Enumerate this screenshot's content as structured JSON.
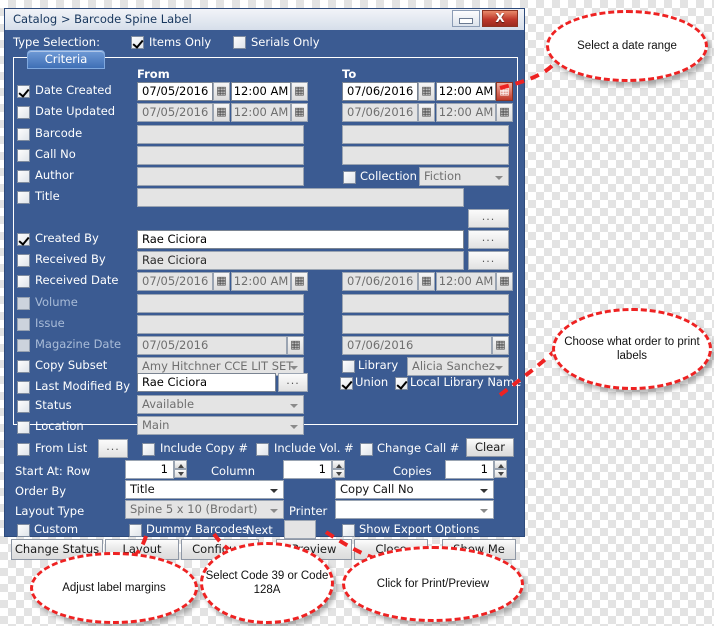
{
  "window": {
    "title": "Catalog > Barcode Spine Label",
    "minimize_label": "minimize",
    "close_label": "X"
  },
  "type_selection": {
    "label": "Type Selection:",
    "items_only": {
      "label": "Items Only",
      "checked": true
    },
    "serials_only": {
      "label": "Serials Only",
      "checked": false
    }
  },
  "criteria": {
    "tab_label": "Criteria",
    "from_header": "From",
    "to_header": "To",
    "rows": [
      {
        "label": "Date Created",
        "checked": true,
        "from_date": "07/05/2016",
        "from_time": "12:00 AM",
        "to_date": "07/06/2016",
        "to_time": "12:00 AM"
      },
      {
        "label": "Date Updated",
        "checked": false,
        "from_date": "07/05/2016",
        "from_time": "12:00 AM",
        "to_date": "07/06/2016",
        "to_time": "12:00 AM"
      },
      {
        "label": "Barcode",
        "checked": false,
        "from_value": "",
        "to_value": ""
      },
      {
        "label": "Call No",
        "checked": false,
        "from_value": "",
        "to_value": ""
      },
      {
        "label": "Author",
        "checked": false,
        "from_value": ""
      },
      {
        "label": "Title",
        "checked": false,
        "value": ""
      },
      {
        "label": "Created By",
        "checked": true,
        "value": "Rae Ciciora"
      },
      {
        "label": "Received By",
        "checked": false,
        "value": "Rae Ciciora"
      },
      {
        "label": "Received Date",
        "checked": false,
        "from_date": "07/05/2016",
        "from_time": "12:00 AM",
        "to_date": "07/06/2016",
        "to_time": "12:00 AM"
      },
      {
        "label": "Volume",
        "checked": false,
        "dim": true,
        "from_value": "",
        "to_value": ""
      },
      {
        "label": "Issue",
        "checked": false,
        "dim": true,
        "from_value": "",
        "to_value": ""
      },
      {
        "label": "Magazine Date",
        "checked": false,
        "dim": true,
        "from_date": "07/05/2016",
        "to_date": "07/06/2016"
      },
      {
        "label": "Copy Subset",
        "checked": false,
        "value": "Amy Hitchner CCE LIT SET"
      },
      {
        "label": "Last Modified By",
        "checked": false,
        "value": "Rae Ciciora"
      },
      {
        "label": "Status",
        "checked": false,
        "value": "Available"
      },
      {
        "label": "Location",
        "checked": false,
        "value": "Main"
      }
    ],
    "collection": {
      "label": "Collection",
      "checked": false,
      "value": "Fiction"
    },
    "library": {
      "label": "Library",
      "checked": false,
      "value": "Alicia Sanchez"
    },
    "union": {
      "label": "Union",
      "checked": true
    },
    "local_library_name": {
      "label": "Local Library Name",
      "checked": true
    },
    "from_list": {
      "label": "From List",
      "checked": false
    },
    "include_copy": {
      "label": "Include Copy #",
      "checked": false
    },
    "include_vol": {
      "label": "Include Vol. #",
      "checked": false
    },
    "change_call": {
      "label": "Change Call #",
      "checked": false
    },
    "clear_button": "Clear",
    "ellipsis": "..."
  },
  "print": {
    "start_at_label": "Start At:  Row",
    "row_value": "1",
    "column_label": "Column",
    "column_value": "1",
    "copies_label": "Copies",
    "copies_value": "1",
    "order_by_label": "Order By",
    "order_by_primary": "Title",
    "order_by_secondary": "Copy Call No",
    "layout_type_label": "Layout Type",
    "layout_type_value": "Spine 5 x 10  (Brodart)",
    "printer_label": "Printer",
    "printer_value": "",
    "custom": {
      "label": "Custom",
      "checked": false
    },
    "dummy_barcodes": {
      "label": "Dummy Barcodes",
      "checked": false
    },
    "next_label": "Next",
    "next_value": "",
    "show_export_options": {
      "label": "Show Export Options",
      "checked": false
    }
  },
  "buttons": {
    "change_status": "Change Status",
    "layout": "Layout",
    "configure": "Configure",
    "preview": "Preview",
    "close": "Close",
    "show_me": "Show Me"
  },
  "annotations": {
    "date_range": "Select a date range",
    "order": "Choose what order to print labels",
    "margins": "Adjust label margins",
    "code": "Select Code 39 or Code 128A",
    "print": "Click for Print/Preview"
  },
  "colors": {
    "panel_blue": "#3b5b92",
    "annotation_red": "#ee2222",
    "tab_blue": "#3f6fb5",
    "close_red": "#c0392b"
  }
}
